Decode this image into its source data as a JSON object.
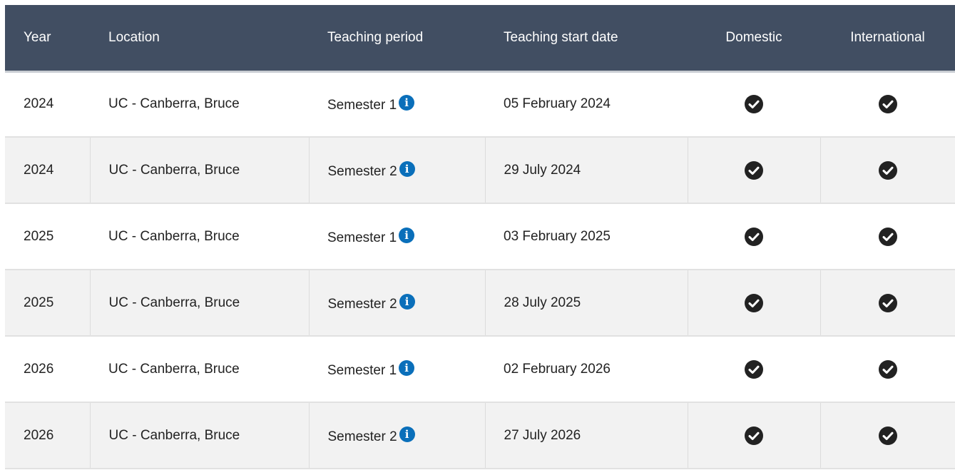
{
  "table": {
    "headers": {
      "year": "Year",
      "location": "Location",
      "teaching_period": "Teaching period",
      "teaching_start_date": "Teaching start date",
      "domestic": "Domestic",
      "international": "International"
    },
    "rows": [
      {
        "year": "2024",
        "location": "UC - Canberra, Bruce",
        "teaching_period": "Semester 1",
        "teaching_start_date": "05 February 2024",
        "domestic": true,
        "international": true
      },
      {
        "year": "2024",
        "location": "UC - Canberra, Bruce",
        "teaching_period": "Semester 2",
        "teaching_start_date": "29 July 2024",
        "domestic": true,
        "international": true
      },
      {
        "year": "2025",
        "location": "UC - Canberra, Bruce",
        "teaching_period": "Semester 1",
        "teaching_start_date": "03 February 2025",
        "domestic": true,
        "international": true
      },
      {
        "year": "2025",
        "location": "UC - Canberra, Bruce",
        "teaching_period": "Semester 2",
        "teaching_start_date": "28 July 2025",
        "domestic": true,
        "international": true
      },
      {
        "year": "2026",
        "location": "UC - Canberra, Bruce",
        "teaching_period": "Semester 1",
        "teaching_start_date": "02 February 2026",
        "domestic": true,
        "international": true
      },
      {
        "year": "2026",
        "location": "UC - Canberra, Bruce",
        "teaching_period": "Semester 2",
        "teaching_start_date": "27 July 2026",
        "domestic": true,
        "international": true
      }
    ]
  },
  "icons": {
    "info": "info-circle-icon",
    "check": "check-circle-icon"
  },
  "colors": {
    "header_bg": "#414e62",
    "header_text": "#ffffff",
    "info_icon": "#0a6fba",
    "check_icon": "#222222",
    "stripe_bg": "#f2f2f2"
  }
}
